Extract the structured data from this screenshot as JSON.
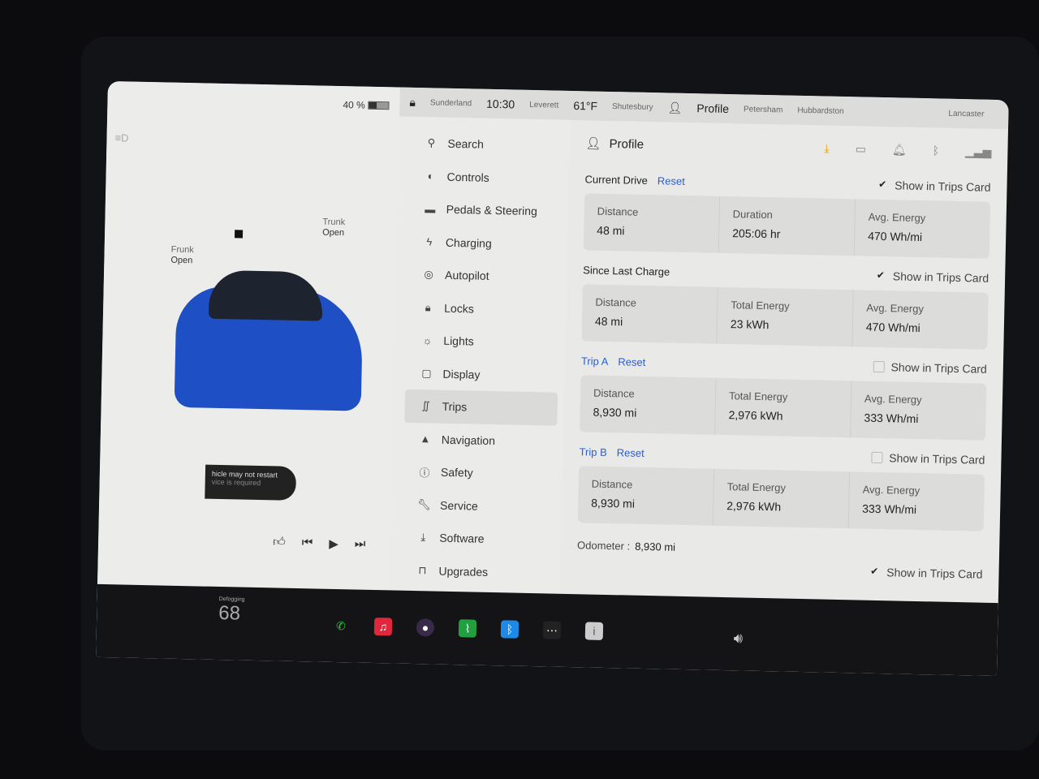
{
  "status": {
    "battery": "40 %",
    "time": "10:30",
    "temperature": "61°F",
    "profile": "Profile",
    "map_labels": [
      "Sunderland",
      "Leverett",
      "Shutesbury",
      "Petersham",
      "Hubbardston",
      "Lancaster"
    ]
  },
  "car": {
    "frunk_label": "Frunk",
    "frunk_state": "Open",
    "trunk_label": "Trunk",
    "trunk_state": "Open",
    "alert_line1": "hicle may not restart",
    "alert_line2": "vice is required"
  },
  "menu": [
    {
      "label": "Search",
      "icon": "search-icon"
    },
    {
      "label": "Controls",
      "icon": "toggle-icon"
    },
    {
      "label": "Pedals & Steering",
      "icon": "car-icon"
    },
    {
      "label": "Charging",
      "icon": "bolt-icon"
    },
    {
      "label": "Autopilot",
      "icon": "steering-wheel-icon"
    },
    {
      "label": "Locks",
      "icon": "lock-icon"
    },
    {
      "label": "Lights",
      "icon": "sun-icon"
    },
    {
      "label": "Display",
      "icon": "display-icon"
    },
    {
      "label": "Trips",
      "icon": "trips-icon",
      "active": true
    },
    {
      "label": "Navigation",
      "icon": "navigation-icon"
    },
    {
      "label": "Safety",
      "icon": "alert-circle-icon"
    },
    {
      "label": "Service",
      "icon": "wrench-icon"
    },
    {
      "label": "Software",
      "icon": "download-icon"
    },
    {
      "label": "Upgrades",
      "icon": "bag-icon"
    }
  ],
  "trips": {
    "profile": "Profile",
    "show_label": "Show in Trips Card",
    "reset": "Reset",
    "current": {
      "title": "Current Drive",
      "checked": true,
      "cells": [
        {
          "label": "Distance",
          "value": "48 mi"
        },
        {
          "label": "Duration",
          "value": "205:06 hr"
        },
        {
          "label": "Avg. Energy",
          "value": "470 Wh/mi"
        }
      ]
    },
    "since": {
      "title": "Since Last Charge",
      "checked": true,
      "cells": [
        {
          "label": "Distance",
          "value": "48 mi"
        },
        {
          "label": "Total Energy",
          "value": "23 kWh"
        },
        {
          "label": "Avg. Energy",
          "value": "470 Wh/mi"
        }
      ]
    },
    "tripa": {
      "title": "Trip A",
      "checked": false,
      "cells": [
        {
          "label": "Distance",
          "value": "8,930 mi"
        },
        {
          "label": "Total Energy",
          "value": "2,976 kWh"
        },
        {
          "label": "Avg. Energy",
          "value": "333 Wh/mi"
        }
      ]
    },
    "tripb": {
      "title": "Trip B",
      "checked": false,
      "cells": [
        {
          "label": "Distance",
          "value": "8,930 mi"
        },
        {
          "label": "Total Energy",
          "value": "2,976 kWh"
        },
        {
          "label": "Avg. Energy",
          "value": "333 Wh/mi"
        }
      ]
    },
    "odometer_label": "Odometer :",
    "odometer_value": "8,930 mi",
    "odometer_checked": true
  },
  "dock": {
    "cabin_temp": "68",
    "cabin_status": "Defogging"
  },
  "colors": {
    "accent": "#2a5fd4",
    "download": "#e8a020"
  }
}
